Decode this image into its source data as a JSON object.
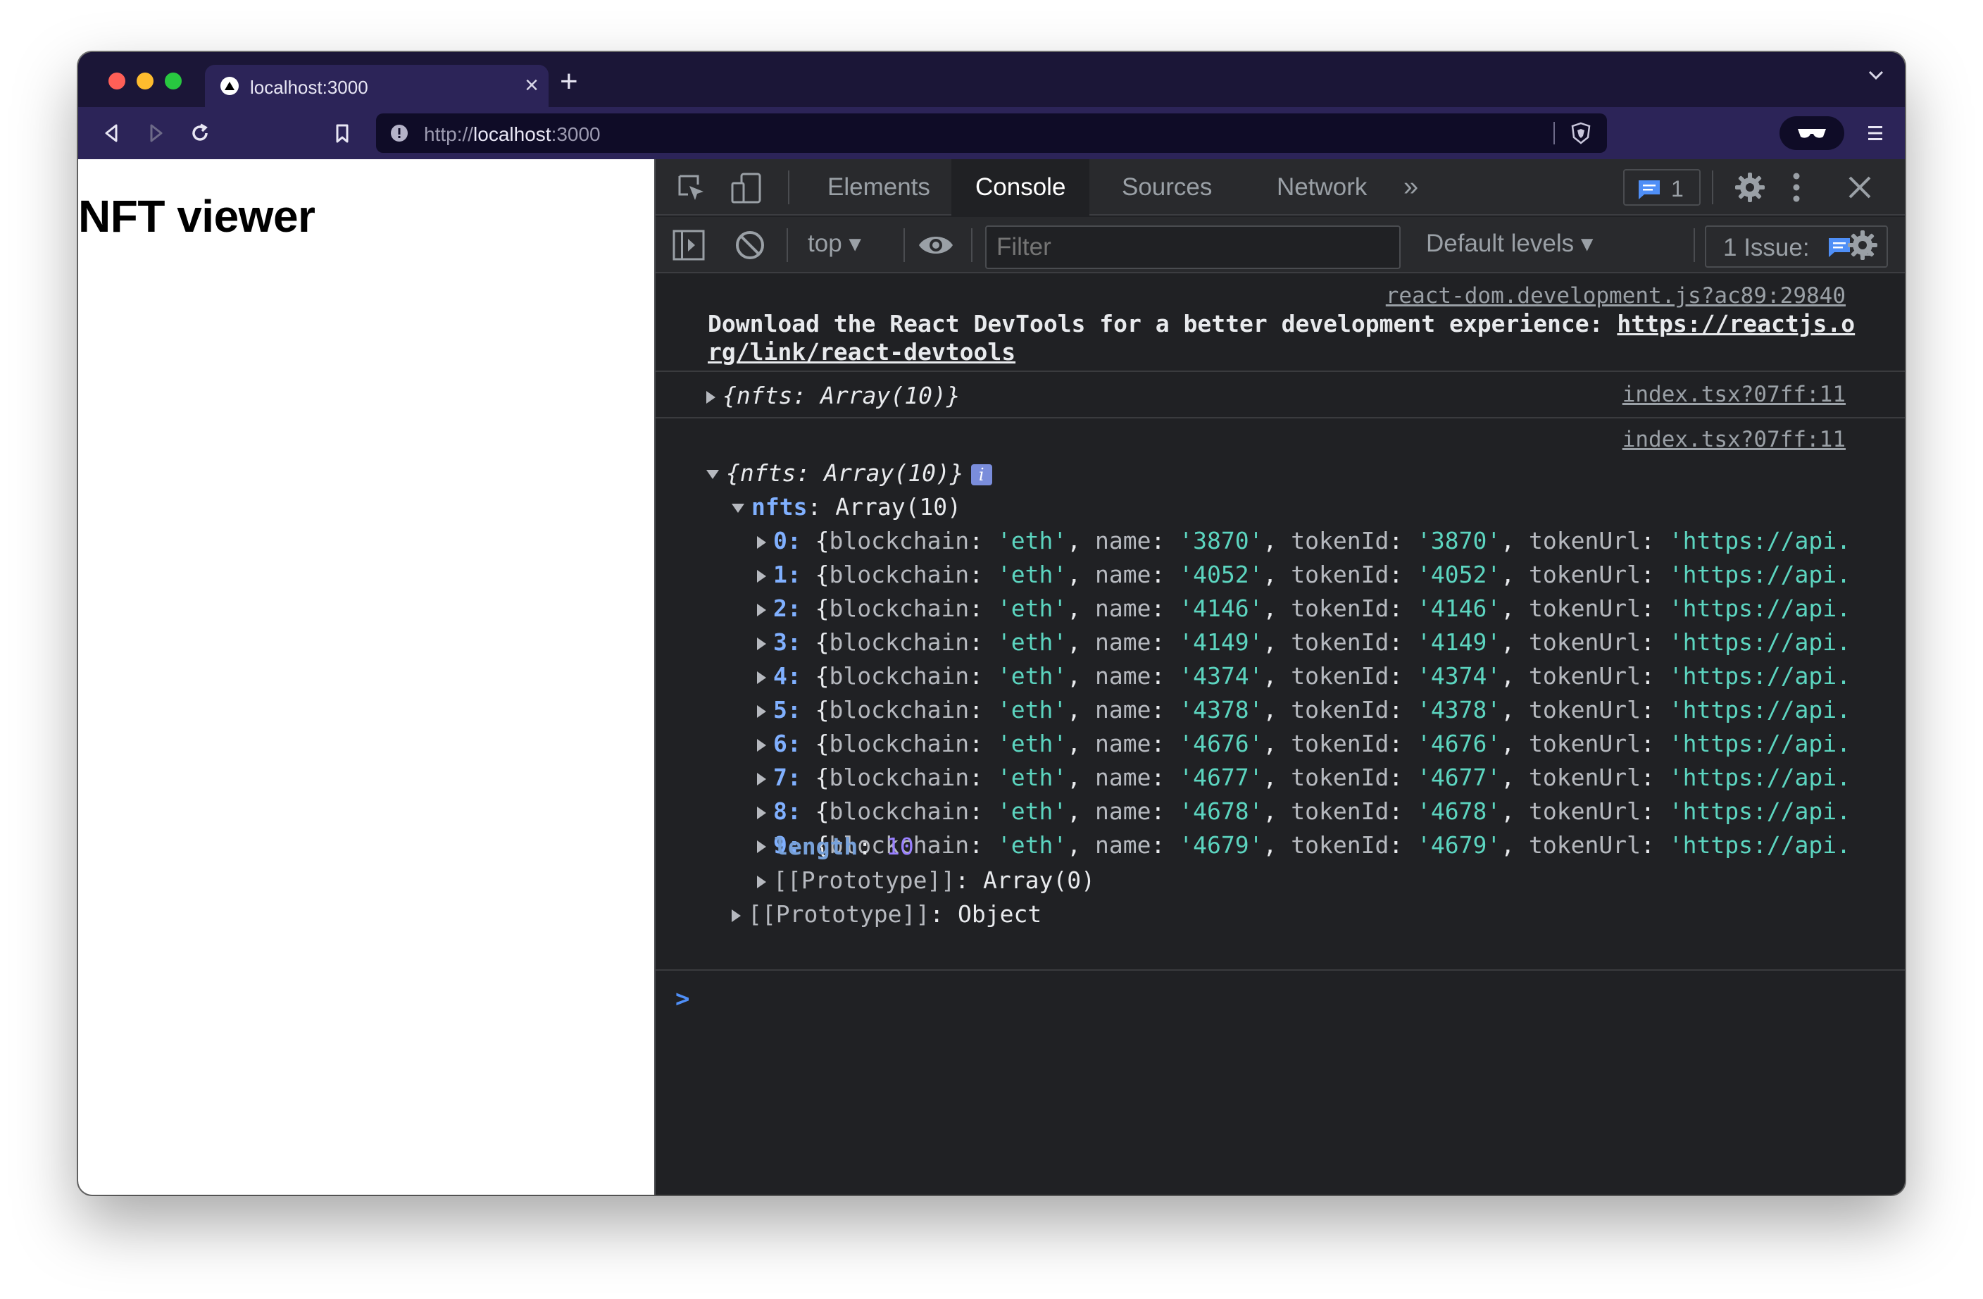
{
  "browser": {
    "tab_title": "localhost:3000",
    "new_tab_label": "+",
    "tab_close_label": "×",
    "url_scheme": "http://",
    "url_host": "localhost",
    "url_port": ":3000"
  },
  "page": {
    "heading": "NFT viewer"
  },
  "devtools": {
    "tabs": [
      "Elements",
      "Console",
      "Sources",
      "Network"
    ],
    "active_tab": "Console",
    "more_tabs": "»",
    "message_count": "1",
    "context": "top",
    "filter_placeholder": "Filter",
    "levels": "Default levels",
    "issues_label": "1 Issue:",
    "issues_count": "1"
  },
  "console": {
    "devtools_msg": {
      "source": "react-dom.development.js?ac89:29840",
      "text": "Download the React DevTools for a better development experience: ",
      "link_part1": "https://reactjs.o",
      "link_part2": "rg/link/react-devtools"
    },
    "log1": {
      "source": "index.tsx?07ff:11",
      "summary": "{nfts: Array(10)}"
    },
    "log2": {
      "source": "index.tsx?07ff:11",
      "summary": "{nfts: Array(10)}",
      "info": "i",
      "nfts_key": "nfts",
      "nfts_value": "Array(10)",
      "items": [
        {
          "index": "0",
          "name": "3870",
          "tokenId": "3870"
        },
        {
          "index": "1",
          "name": "4052",
          "tokenId": "4052"
        },
        {
          "index": "2",
          "name": "4146",
          "tokenId": "4146"
        },
        {
          "index": "3",
          "name": "4149",
          "tokenId": "4149"
        },
        {
          "index": "4",
          "name": "4374",
          "tokenId": "4374"
        },
        {
          "index": "5",
          "name": "4378",
          "tokenId": "4378"
        },
        {
          "index": "6",
          "name": "4676",
          "tokenId": "4676"
        },
        {
          "index": "7",
          "name": "4677",
          "tokenId": "4677"
        },
        {
          "index": "8",
          "name": "4678",
          "tokenId": "4678"
        },
        {
          "index": "9",
          "name": "4679",
          "tokenId": "4679"
        }
      ],
      "blockchain_value": "'eth'",
      "token_url_value": "'https://api.",
      "length_key": "length",
      "length_value": "10",
      "array_proto": "[[Prototype]]",
      "array_proto_value": "Array(0)",
      "object_proto": "[[Prototype]]",
      "object_proto_value": "Object"
    },
    "prompt": ">"
  },
  "colors": {
    "string": "#5cd5c0",
    "index": "#80b0ff",
    "number": "#9980ff",
    "tabbar": "#1b1637",
    "toolbar": "#2c2458"
  }
}
